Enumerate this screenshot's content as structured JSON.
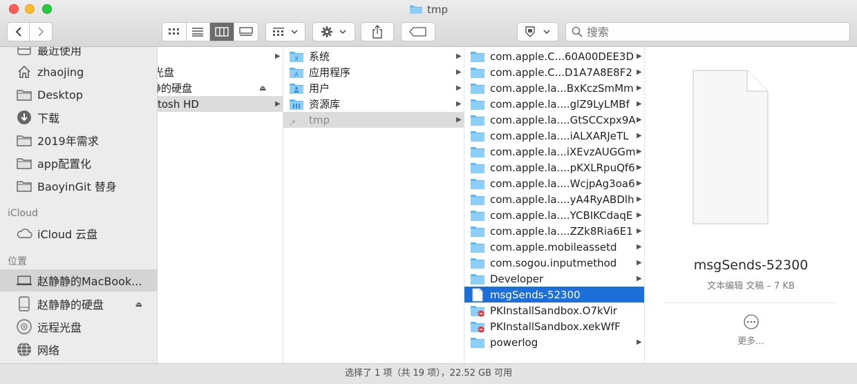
{
  "window": {
    "title": "tmp"
  },
  "toolbar": {
    "back": "back",
    "forward": "forward",
    "view_modes": [
      "icon-view",
      "list-view",
      "column-view",
      "gallery-view"
    ],
    "active_view": "column-view",
    "search_placeholder": "搜索"
  },
  "sidebar": {
    "favorites": [
      {
        "label": "最近使用",
        "icon": "recents-icon"
      },
      {
        "label": "zhaojing",
        "icon": "home-icon"
      },
      {
        "label": "Desktop",
        "icon": "folder-icon"
      },
      {
        "label": "下载",
        "icon": "download-icon"
      },
      {
        "label": "2019年需求",
        "icon": "folder-icon"
      },
      {
        "label": "app配置化",
        "icon": "folder-icon"
      },
      {
        "label": "BaoyinGit 替身",
        "icon": "folder-icon"
      }
    ],
    "icloud_heading": "iCloud",
    "icloud": [
      {
        "label": "iCloud 云盘",
        "icon": "cloud-icon"
      }
    ],
    "locations_heading": "位置",
    "locations": [
      {
        "label": "赵静静的MacBook...",
        "icon": "laptop-icon",
        "selected": true
      },
      {
        "label": "赵静静的硬盘",
        "icon": "disk-icon",
        "eject": true
      },
      {
        "label": "远程光盘",
        "icon": "disc-icon"
      },
      {
        "label": "网络",
        "icon": "network-icon"
      }
    ]
  },
  "col1": [
    {
      "label": "",
      "arrow": true
    },
    {
      "label": "光盘",
      "arrow": false
    },
    {
      "label": "静的硬盘",
      "arrow": false,
      "eject": true
    },
    {
      "label": "tosh HD",
      "arrow": true,
      "highlight": true
    }
  ],
  "col2": [
    {
      "label": "系统",
      "arrow": true
    },
    {
      "label": "应用程序",
      "arrow": true
    },
    {
      "label": "用户",
      "arrow": true
    },
    {
      "label": "资源库",
      "arrow": true
    },
    {
      "label": "tmp",
      "arrow": true,
      "highlight": true
    }
  ],
  "col3": [
    {
      "label": "com.apple.C...60A00DEE3D",
      "type": "folder",
      "arrow": true
    },
    {
      "label": "com.apple.C...D1A7A8E8F2",
      "type": "folder",
      "arrow": true
    },
    {
      "label": "com.apple.la...BxKczSmMm",
      "type": "folder",
      "arrow": true
    },
    {
      "label": "com.apple.la....glZ9LyLMBf",
      "type": "folder",
      "arrow": true
    },
    {
      "label": "com.apple.la....GtSCCxpx9A",
      "type": "folder",
      "arrow": true
    },
    {
      "label": "com.apple.la....iALXARJeTL",
      "type": "folder",
      "arrow": true
    },
    {
      "label": "com.apple.la...iXEvzAUGGm",
      "type": "folder",
      "arrow": true
    },
    {
      "label": "com.apple.la....pKXLRpuQf6",
      "type": "folder",
      "arrow": true
    },
    {
      "label": "com.apple.la....WcjpAg3oa6",
      "type": "folder",
      "arrow": true
    },
    {
      "label": "com.apple.la....yA4RyABDlh",
      "type": "folder",
      "arrow": true
    },
    {
      "label": "com.apple.la....YCBIKCdaqE",
      "type": "folder",
      "arrow": true
    },
    {
      "label": "com.apple.la....ZZk8Ria6E1",
      "type": "folder",
      "arrow": true
    },
    {
      "label": "com.apple.mobileassetd",
      "type": "folder",
      "arrow": true
    },
    {
      "label": "com.sogou.inputmethod",
      "type": "folder",
      "arrow": true
    },
    {
      "label": "Developer",
      "type": "folder",
      "arrow": true
    },
    {
      "label": "msgSends-52300",
      "type": "file",
      "arrow": false,
      "selected": true
    },
    {
      "label": "PKInstallSandbox.O7kVir",
      "type": "locked-folder",
      "arrow": false
    },
    {
      "label": "PKInstallSandbox.xekWfF",
      "type": "locked-folder",
      "arrow": false
    },
    {
      "label": "powerlog",
      "type": "folder",
      "arrow": true
    }
  ],
  "preview": {
    "name": "msgSends-52300",
    "meta": "文本编辑 文稿 – 7 KB",
    "more_label": "更多..."
  },
  "status": {
    "text": "选择了 1 项（共 19 项），22.52 GB 可用"
  },
  "colors": {
    "selection": "#1c6fd9",
    "folder": "#5fb7f2",
    "sidebar_bg": "#ececec"
  }
}
